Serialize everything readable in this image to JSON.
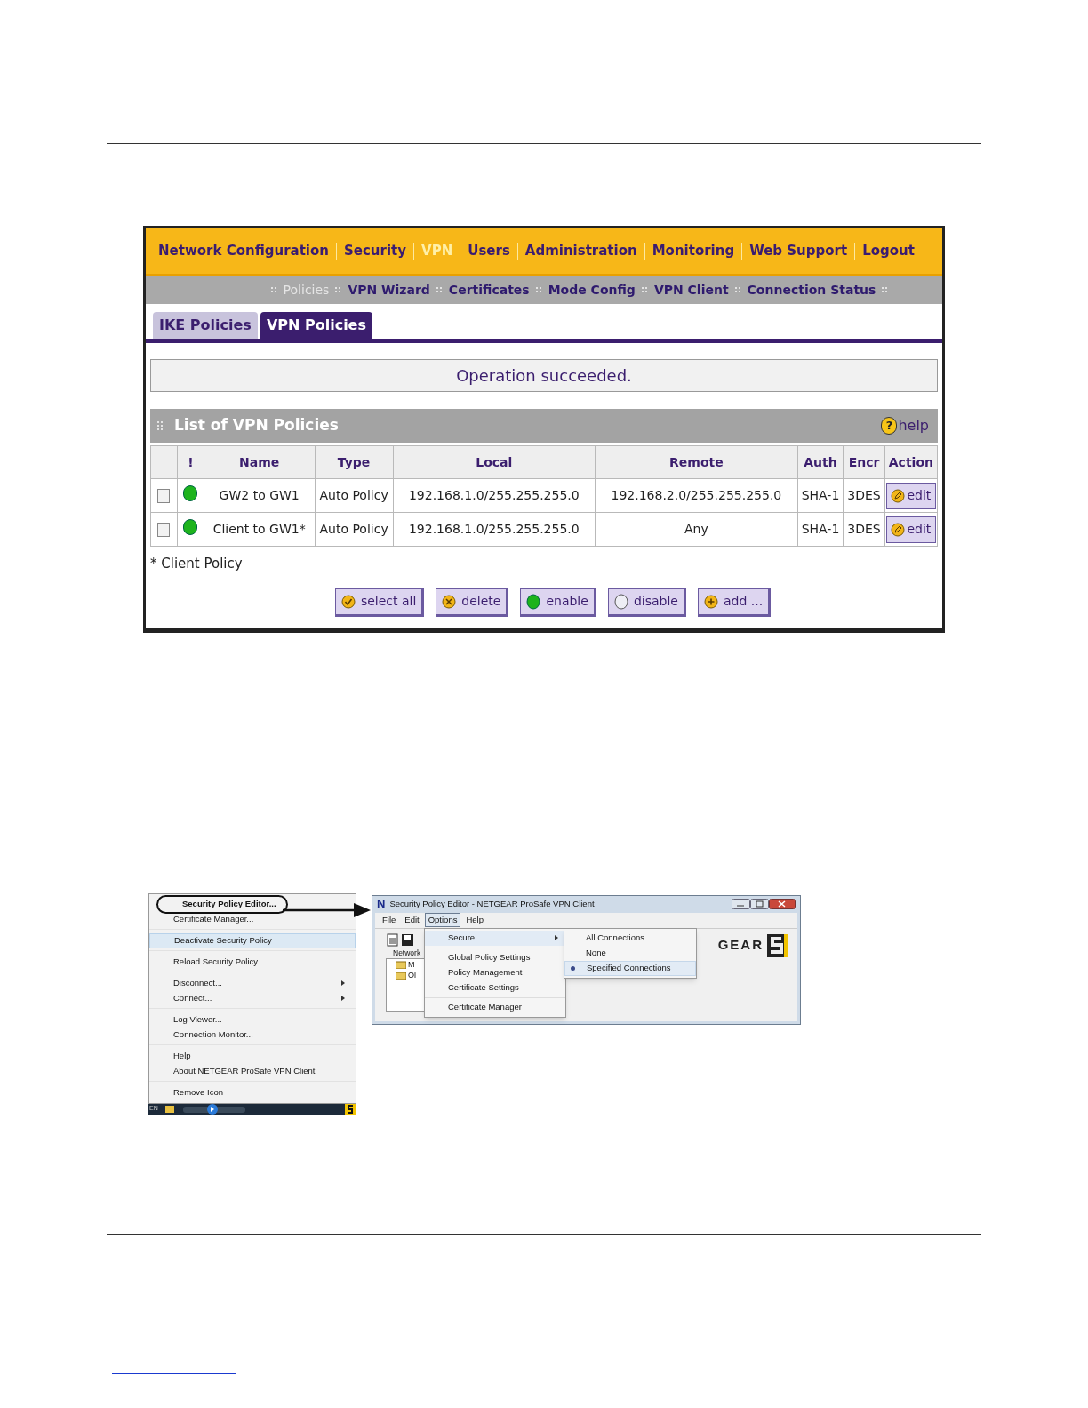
{
  "router_ui": {
    "top_menu": [
      {
        "label": "Network Configuration",
        "selected": false
      },
      {
        "label": "Security",
        "selected": false
      },
      {
        "label": "VPN",
        "selected": true
      },
      {
        "label": "Users",
        "selected": false
      },
      {
        "label": "Administration",
        "selected": false
      },
      {
        "label": "Monitoring",
        "selected": false
      },
      {
        "label": "Web Support",
        "selected": false
      },
      {
        "label": "Logout",
        "selected": false
      }
    ],
    "sub_menu": [
      {
        "label": "Policies",
        "selected": true
      },
      {
        "label": "VPN Wizard",
        "selected": false
      },
      {
        "label": "Certificates",
        "selected": false
      },
      {
        "label": "Mode Config",
        "selected": false
      },
      {
        "label": "VPN Client",
        "selected": false
      },
      {
        "label": "Connection Status",
        "selected": false
      }
    ],
    "tabs": [
      {
        "label": "IKE Policies",
        "selected": false
      },
      {
        "label": "VPN Policies",
        "selected": true
      }
    ],
    "message": "Operation succeeded.",
    "section": {
      "title": "List of VPN Policies",
      "help_icon": "?",
      "help": "help"
    },
    "table": {
      "columns": [
        "!",
        "Name",
        "Type",
        "Local",
        "Remote",
        "Auth",
        "Encr",
        "Action"
      ],
      "rows": [
        {
          "checked": false,
          "active": true,
          "name": "GW2 to GW1",
          "type": "Auto Policy",
          "local": "192.168.1.0/255.255.255.0",
          "remote": "192.168.2.0/255.255.255.0",
          "auth": "SHA-1",
          "encr": "3DES",
          "action": "edit"
        },
        {
          "checked": false,
          "active": true,
          "name": "Client to GW1*",
          "type": "Auto Policy",
          "local": "192.168.1.0/255.255.255.0",
          "remote": "Any",
          "auth": "SHA-1",
          "encr": "3DES",
          "action": "edit"
        }
      ]
    },
    "footnote": "* Client Policy",
    "buttons": [
      {
        "label": "select all",
        "kind": "select"
      },
      {
        "label": "delete",
        "kind": "delete"
      },
      {
        "label": "enable",
        "kind": "enable"
      },
      {
        "label": "disable",
        "kind": "disable"
      },
      {
        "label": "add ...",
        "kind": "add"
      }
    ]
  },
  "tray_menu": {
    "groups": [
      [
        {
          "label": "Security Policy Editor...",
          "bold": true,
          "callout": true,
          "selected": false,
          "submenu": false
        },
        {
          "label": "Certificate Manager...",
          "bold": false,
          "callout": false,
          "selected": false,
          "submenu": false
        }
      ],
      [
        {
          "label": "Deactivate Security Policy",
          "bold": false,
          "callout": false,
          "selected": true,
          "submenu": false
        }
      ],
      [
        {
          "label": "Reload Security Policy",
          "bold": false,
          "callout": false,
          "selected": false,
          "submenu": false
        }
      ],
      [
        {
          "label": "Disconnect...",
          "bold": false,
          "callout": false,
          "selected": false,
          "submenu": true
        },
        {
          "label": "Connect...",
          "bold": false,
          "callout": false,
          "selected": false,
          "submenu": true
        }
      ],
      [
        {
          "label": "Log Viewer...",
          "bold": false,
          "callout": false,
          "selected": false,
          "submenu": false
        },
        {
          "label": "Connection Monitor...",
          "bold": false,
          "callout": false,
          "selected": false,
          "submenu": false
        }
      ],
      [
        {
          "label": "Help",
          "bold": false,
          "callout": false,
          "selected": false,
          "submenu": false
        },
        {
          "label": "About NETGEAR ProSafe VPN Client",
          "bold": false,
          "callout": false,
          "selected": false,
          "submenu": false
        }
      ],
      [
        {
          "label": "Remove Icon",
          "bold": false,
          "callout": false,
          "selected": false,
          "submenu": false
        }
      ]
    ],
    "taskbar_language": "EN"
  },
  "editor_window": {
    "title": "Security Policy Editor - NETGEAR ProSafe VPN Client",
    "logo_letter": "N",
    "menu_bar": [
      {
        "label": "File",
        "selected": false
      },
      {
        "label": "Edit",
        "selected": false
      },
      {
        "label": "Options",
        "selected": true
      },
      {
        "label": "Help",
        "selected": false
      }
    ],
    "options_menu": [
      [
        {
          "label": "Secure",
          "submenu": true,
          "selected": true
        }
      ],
      [
        {
          "label": "Global Policy Settings",
          "submenu": false,
          "selected": false
        },
        {
          "label": "Policy Management",
          "submenu": false,
          "selected": false
        },
        {
          "label": "Certificate Settings",
          "submenu": false,
          "selected": false
        }
      ],
      [
        {
          "label": "Certificate Manager",
          "submenu": false,
          "selected": false
        }
      ]
    ],
    "secure_menu": [
      {
        "label": "All Connections",
        "selected": false
      },
      {
        "label": "None",
        "selected": false
      },
      {
        "label": "Specified Connections",
        "selected": true
      }
    ],
    "panel_label": "Network",
    "tree": [
      {
        "label": "M"
      },
      {
        "label": "Ol"
      }
    ],
    "brand_text": "GEAR"
  }
}
